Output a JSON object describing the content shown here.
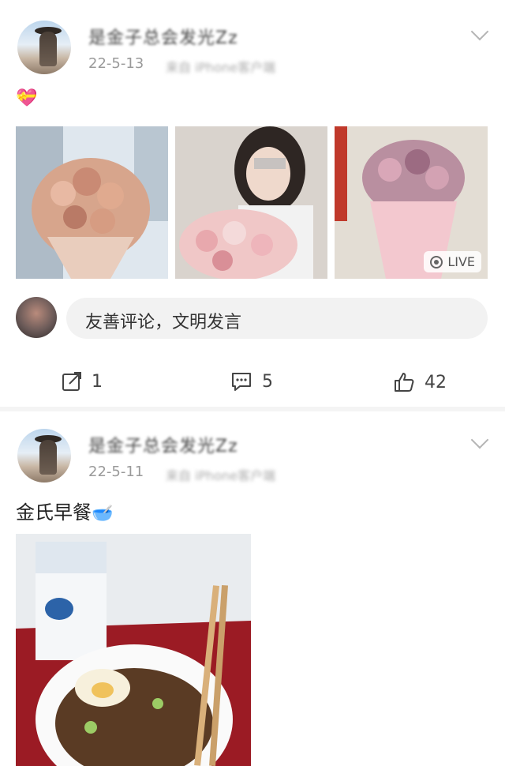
{
  "posts": [
    {
      "username": "是金子总会发光Zz",
      "date": "22-5-13",
      "source": "来自 iPhone客户端",
      "text_emoji": "💝",
      "photos": [
        {
          "label": "bouquet-1"
        },
        {
          "label": "selfie-with-bouquet"
        },
        {
          "label": "bouquet-2"
        }
      ],
      "live_badge": "LIVE",
      "comment_placeholder": "友善评论，文明发言",
      "actions": {
        "share_count": "1",
        "comment_count": "5",
        "like_count": "42"
      }
    },
    {
      "username": "是金子总会发光Zz",
      "date": "22-5-11",
      "source": "来自 iPhone客户端",
      "text": "金氏早餐",
      "text_emoji": "🥣"
    }
  ]
}
